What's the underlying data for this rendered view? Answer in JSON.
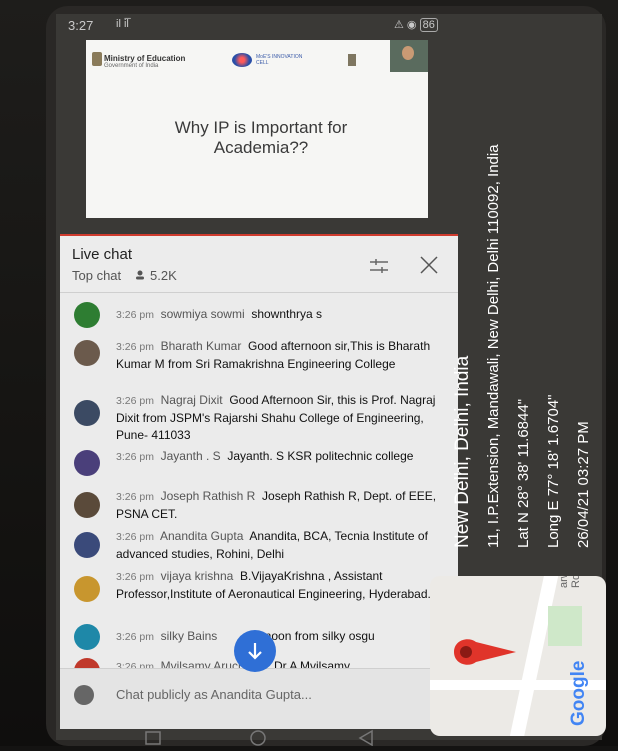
{
  "status_bar": {
    "time": "3:27",
    "signal": "il il̅",
    "battery": "86"
  },
  "slide": {
    "org_name": "Ministry of Education",
    "org_sub": "Government of India",
    "cell_name": "MoE'S INNOVATION CELL",
    "title": "Why IP is Important for Academia??"
  },
  "chat": {
    "title": "Live chat",
    "mode": "Top chat",
    "viewer_count": "5.2K",
    "messages": [
      {
        "time": "3:26 pm",
        "author": "sowmiya sowmi",
        "text": "shownthrya s"
      },
      {
        "time": "3:26 pm",
        "author": "Bharath Kumar",
        "text": "Good afternoon sir,This is Bharath Kumar M from Sri Ramakrishna Engineering College"
      },
      {
        "time": "3:26 pm",
        "author": "Nagraj Dixit",
        "text": "Good Afternoon Sir, this is Prof. Nagraj Dixit from JSPM's Rajarshi Shahu College of Engineering, Pune- 411033"
      },
      {
        "time": "3:26 pm",
        "author": "Jayanth . S",
        "text": "Jayanth. S KSR politechnic college"
      },
      {
        "time": "3:26 pm",
        "author": "Joseph Rathish R",
        "text": "Joseph Rathish R, Dept. of EEE, PSNA CET."
      },
      {
        "time": "3:26 pm",
        "author": "Anandita Gupta",
        "text": "Anandita, BCA, Tecnia Institute of advanced studies, Rohini, Delhi"
      },
      {
        "time": "3:26 pm",
        "author": "vijaya krishna",
        "text": "B.VijayaKrishna , Assistant Professor,Institute of Aeronautical Engineering, Hyderabad."
      },
      {
        "time": "3:26 pm",
        "author": "silky Bains",
        "text": "fternoon from silky osgu"
      },
      {
        "time": "3:26 pm",
        "author": "Mvilsamy Aruchamy",
        "text": "Dr A Mvilsamy"
      }
    ],
    "input_placeholder": "Chat publicly as Anandita Gupta..."
  },
  "geotag": {
    "city": "New Delhi, Delhi, India",
    "address": "11, I.P.Extension, Mandawali, New Delhi, Delhi 110092, India",
    "lat": "Lat N 28° 38' 11.6844\"",
    "long": "Long E 77° 18' 1.6704\"",
    "datetime": "26/04/21 03:27 PM"
  },
  "map": {
    "road_label": "arwana Rd",
    "logo_text": "Google"
  },
  "colors": {
    "accent_red": "#cf3b2e",
    "fab_blue": "#2f6fd6",
    "pin_red": "#e0342a"
  }
}
